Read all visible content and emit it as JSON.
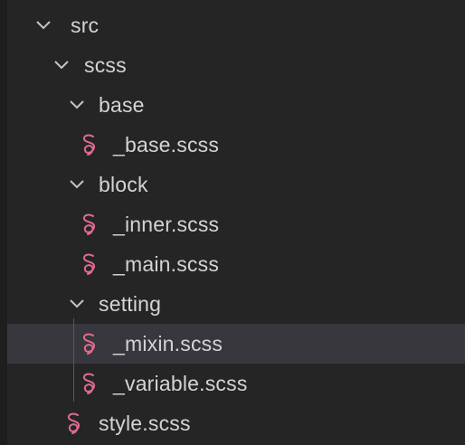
{
  "colors": {
    "background": "#252526",
    "selected_row": "#37373d",
    "text": "#d4d4d4",
    "chevron": "#c5c5c5",
    "sass_icon": "#e06c8f",
    "indent_guide": "#585858"
  },
  "explorer": {
    "items": [
      {
        "label": "src",
        "type": "folder",
        "expanded": true,
        "icon": "chevron-down-icon"
      },
      {
        "label": "scss",
        "type": "folder",
        "expanded": true,
        "icon": "chevron-down-icon"
      },
      {
        "label": "base",
        "type": "folder",
        "expanded": true,
        "icon": "chevron-down-icon"
      },
      {
        "label": "_base.scss",
        "type": "file",
        "icon": "sass-file-icon"
      },
      {
        "label": "block",
        "type": "folder",
        "expanded": true,
        "icon": "chevron-down-icon"
      },
      {
        "label": "_inner.scss",
        "type": "file",
        "icon": "sass-file-icon"
      },
      {
        "label": "_main.scss",
        "type": "file",
        "icon": "sass-file-icon"
      },
      {
        "label": "setting",
        "type": "folder",
        "expanded": true,
        "icon": "chevron-down-icon"
      },
      {
        "label": "_mixin.scss",
        "type": "file",
        "icon": "sass-file-icon",
        "selected": true
      },
      {
        "label": "_variable.scss",
        "type": "file",
        "icon": "sass-file-icon"
      },
      {
        "label": "style.scss",
        "type": "file",
        "icon": "sass-file-icon"
      }
    ]
  }
}
